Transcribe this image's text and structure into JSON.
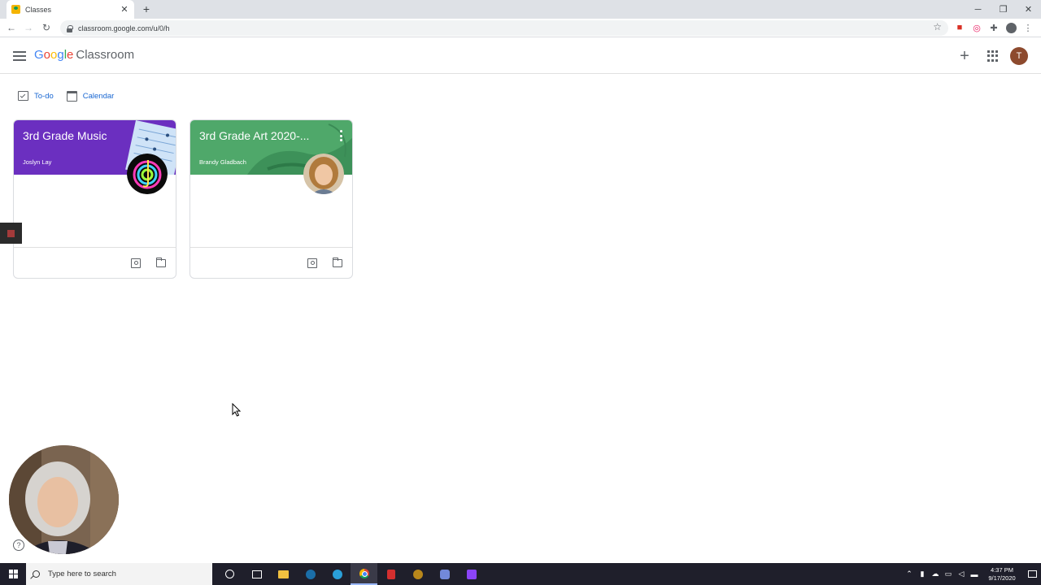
{
  "browser": {
    "tab_title": "Classes",
    "url": "classroom.google.com/u/0/h"
  },
  "app": {
    "logo_google": [
      "G",
      "o",
      "o",
      "g",
      "l",
      "e"
    ],
    "logo_product": "Classroom",
    "account_initial": "T"
  },
  "subnav": {
    "todo": "To-do",
    "calendar": "Calendar"
  },
  "classes": [
    {
      "title": "3rd Grade Music",
      "teacher": "Joslyn Lay",
      "color": "#6b2fc0"
    },
    {
      "title": "3rd Grade Art 2020-...",
      "teacher": "Brandy Gladbach",
      "color": "#4fa86a"
    }
  ],
  "taskbar": {
    "search_placeholder": "Type here to search",
    "time": "4:37 PM",
    "date": "9/17/2020"
  },
  "colors": {
    "google_blue": "#4285f4",
    "google_red": "#ea4335",
    "google_yellow": "#fbbc05",
    "google_green": "#34a853",
    "link_blue": "#1967d2"
  }
}
